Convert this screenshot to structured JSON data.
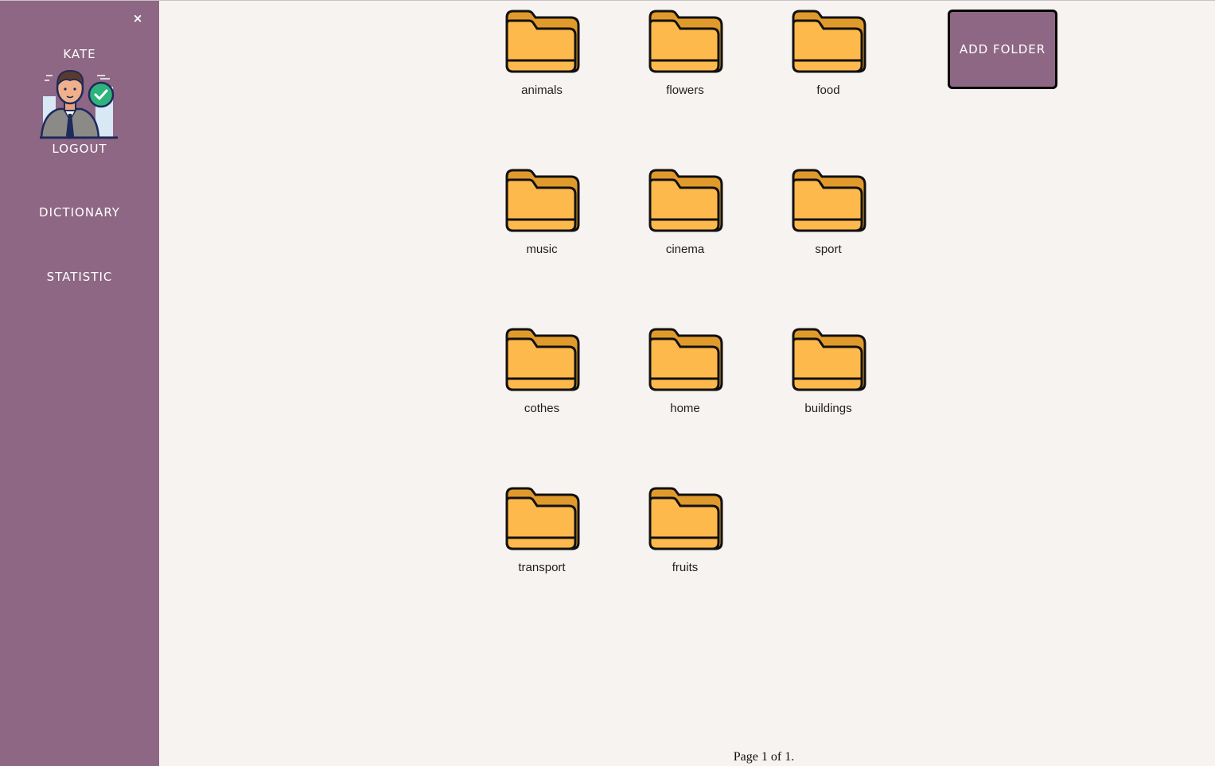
{
  "sidebar": {
    "close_symbol": "×",
    "user_name": "KATE",
    "logout_label": "LOGOUT",
    "nav": [
      {
        "label": "DICTIONARY"
      },
      {
        "label": "STATISTIC"
      }
    ]
  },
  "folders": [
    {
      "label": "animals"
    },
    {
      "label": "flowers"
    },
    {
      "label": "food"
    },
    {
      "label": "music"
    },
    {
      "label": "cinema"
    },
    {
      "label": "sport"
    },
    {
      "label": "cothes"
    },
    {
      "label": "home"
    },
    {
      "label": "buildings"
    },
    {
      "label": "transport"
    },
    {
      "label": "fruits"
    }
  ],
  "add_folder_label": "ADD FOLDER",
  "pagination": "Page 1 of 1.",
  "colors": {
    "sidebar": "#8e6784",
    "background": "#f7f3f0",
    "folder_body": "#fdb94c",
    "folder_back": "#e09a2c"
  },
  "icons": {
    "folder": "folder-icon",
    "avatar": "user-avatar",
    "close": "close-icon"
  }
}
